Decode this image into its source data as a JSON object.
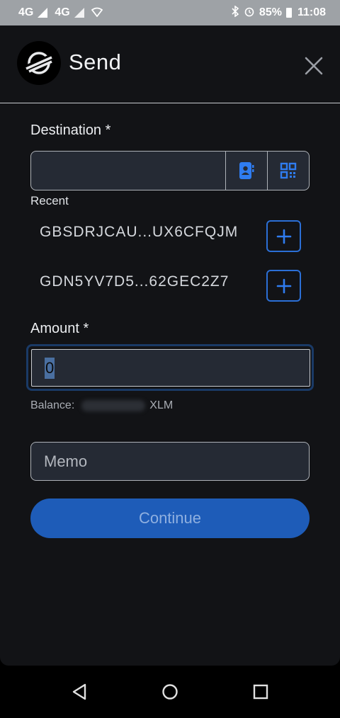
{
  "status_bar": {
    "network1": "4G",
    "network2": "4G",
    "battery": "85%",
    "time": "11:08",
    "icons": [
      "bluetooth-icon",
      "alarm-icon",
      "battery-icon",
      "wifi-icon",
      "signal-icon"
    ]
  },
  "header": {
    "title": "Send",
    "logo_icon": "stellar-logo-icon",
    "close_icon": "close-icon"
  },
  "destination": {
    "label": "Destination *",
    "value": "",
    "placeholder": "",
    "contacts_icon": "contact-book-icon",
    "qr_icon": "qr-code-icon"
  },
  "recent": {
    "label": "Recent",
    "items": [
      {
        "address": "GBSDRJCAU...UX6CFQJM"
      },
      {
        "address": "GDN5YV7D5...62GEC2Z7"
      }
    ],
    "add_icon": "plus-icon"
  },
  "amount": {
    "label": "Amount *",
    "value": "0"
  },
  "balance": {
    "label": "Balance:",
    "unit": "XLM"
  },
  "memo": {
    "placeholder": "Memo"
  },
  "continue": {
    "label": "Continue"
  },
  "nav": {
    "icons": [
      "back-triangle-icon",
      "home-circle-icon",
      "recents-square-icon"
    ]
  },
  "colors": {
    "accent": "#1e5cb8",
    "outline_accent": "#2b6fd6",
    "background": "#121316",
    "input_bg": "#252a34"
  }
}
